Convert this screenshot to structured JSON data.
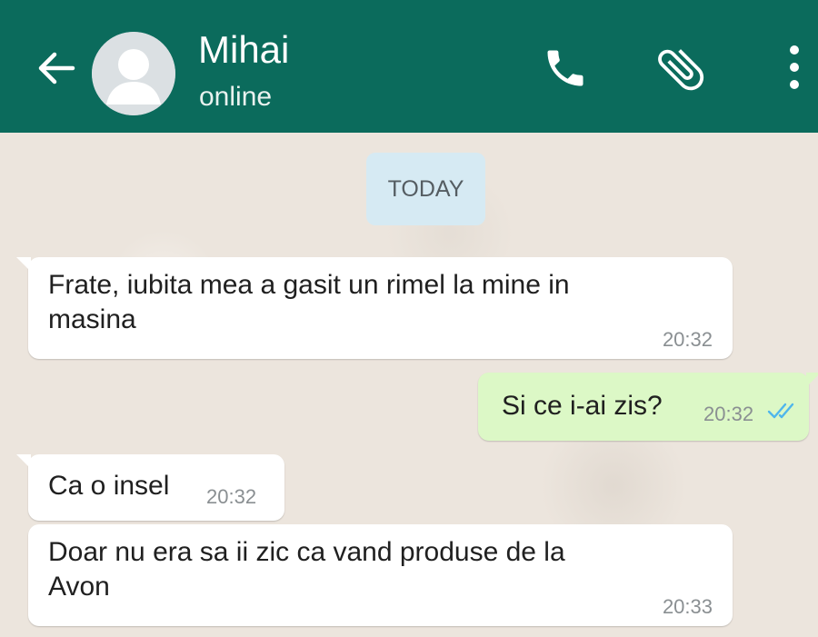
{
  "header": {
    "contact_name": "Mihai",
    "status": "online",
    "background_color": "#0b6b5c",
    "icons": [
      "back-arrow-icon",
      "avatar-placeholder",
      "phone-icon",
      "paperclip-icon",
      "more-vertical-icon"
    ]
  },
  "chat": {
    "date_separator": "TODAY",
    "messages": [
      {
        "direction": "incoming",
        "text": "Frate, iubita mea a gasit un rimel la mine in\nmasina",
        "time": "20:32"
      },
      {
        "direction": "outgoing",
        "text": "Si ce i-ai zis?",
        "time": "20:32",
        "status": "read"
      },
      {
        "direction": "incoming",
        "text": "Ca o insel",
        "time": "20:32"
      },
      {
        "direction": "incoming",
        "text": "Doar nu era sa ii zic ca vand produse de la\nAvon",
        "time": "20:33"
      }
    ]
  },
  "colors": {
    "incoming_bubble": "#ffffff",
    "outgoing_bubble": "#dcf8c6",
    "read_ticks": "#4fb6ec",
    "date_chip": "#d6eaf3"
  }
}
